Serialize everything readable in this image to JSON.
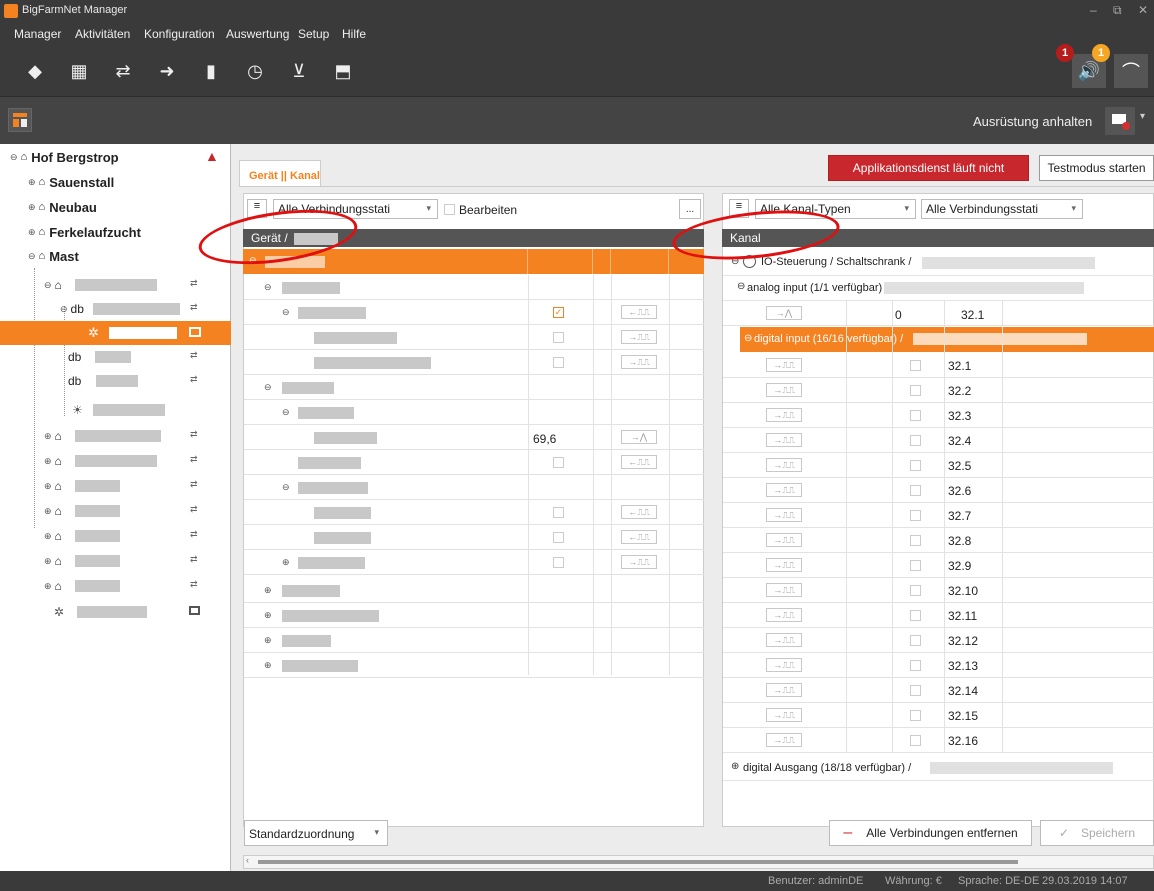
{
  "app": {
    "title": "BigFarmNet Manager"
  },
  "menu": [
    "Manager",
    "Aktivitäten",
    "Konfiguration",
    "Auswertung",
    "Setup",
    "Hilfe"
  ],
  "toolbar": {
    "badges": [
      "1",
      "1"
    ]
  },
  "subbar": {
    "action_label": "Ausrüstung anhalten"
  },
  "tree": {
    "root": "Hof Bergstrop",
    "items": [
      "Sauenstall",
      "Neubau",
      "Ferkelaufzucht",
      "Mast"
    ],
    "db_label": "db"
  },
  "main": {
    "tab": "Gerät || Kanal",
    "status_button": "Applikationsdienst läuft nicht",
    "test_button": "Testmodus starten"
  },
  "left_panel": {
    "filter": "Alle Verbindungsstati",
    "edit_label": "Bearbeiten",
    "more_button": "...",
    "header": "Gerät /",
    "value_69": "69,6"
  },
  "right_panel": {
    "filter_type": "Alle Kanal-Typen",
    "filter_status": "Alle Verbindungsstati",
    "header": "Kanal",
    "io_label": "IO-Steuerung / Schaltschrank /",
    "analog_label": "analog input (1/1 verfügbar) /",
    "analog_value": "0",
    "analog_channel": "32.1",
    "digital_label": "digital input (16/16 verfügbar) /",
    "digital_channels": [
      "32.1",
      "32.2",
      "32.3",
      "32.4",
      "32.5",
      "32.6",
      "32.7",
      "32.8",
      "32.9",
      "32.10",
      "32.11",
      "32.12",
      "32.13",
      "32.14",
      "32.15",
      "32.16"
    ],
    "output_label": "digital Ausgang (18/18 verfügbar) /"
  },
  "bottom": {
    "default_mapping": "Standardzuordnung",
    "remove_all": "Alle Verbindungen entfernen",
    "save": "Speichern"
  },
  "statusbar": {
    "user": "Benutzer: adminDE",
    "currency": "Währung: €",
    "language": "Sprache: DE-DE",
    "datetime": "29.03.2019  14:07"
  },
  "colors": {
    "accent": "#f58220",
    "danger": "#c8282d",
    "dark": "#3a3a3a"
  }
}
